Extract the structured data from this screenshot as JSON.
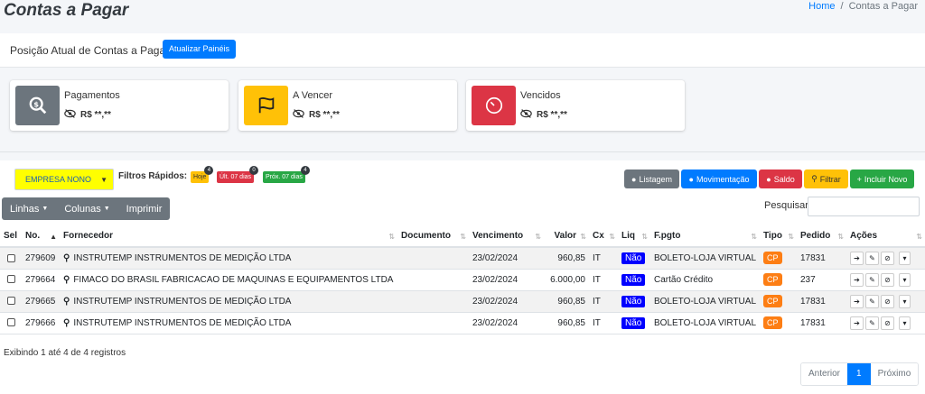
{
  "header": {
    "title": "Contas a Pagar",
    "breadcrumb_home": "Home",
    "breadcrumb_sep": "/",
    "breadcrumb_current": "Contas a Pagar"
  },
  "position": {
    "title": "Posição Atual de Contas a Pagar",
    "refresh_label": "Atualizar Painéis"
  },
  "cards": [
    {
      "label": "Pagamentos",
      "value": "R$ **,**",
      "color": "#6c757d",
      "icon": "search-dollar-icon"
    },
    {
      "label": "A Vencer",
      "value": "R$ **,**",
      "color": "#ffc107",
      "icon": "flag-icon"
    },
    {
      "label": "Vencidos",
      "value": "R$ **,**",
      "color": "#dc3545",
      "icon": "clock-icon"
    }
  ],
  "filters": {
    "empresa": "EMPRESA NONO",
    "quick_label": "Filtros Rápidos:",
    "quick": [
      {
        "label": "Hoje",
        "count": "4",
        "bg": "#ffc107",
        "fg": "#333"
      },
      {
        "label": "Últ. 07 dias",
        "count": "0",
        "bg": "#dc3545",
        "fg": "#fff"
      },
      {
        "label": "Próx. 07 dias",
        "count": "4",
        "bg": "#28a745",
        "fg": "#fff"
      }
    ]
  },
  "actions": {
    "listagem": "Listagem",
    "movimentacao": "Movimentação",
    "saldo": "Saldo",
    "filtrar": "Filtrar",
    "incluir": "Incluir Novo"
  },
  "toolbar": {
    "linhas": "Linhas",
    "colunas": "Colunas",
    "imprimir": "Imprimir",
    "search_label": "Pesquisar"
  },
  "table": {
    "headers": {
      "sel": "Sel",
      "no": "No.",
      "fornecedor": "Fornecedor",
      "documento": "Documento",
      "vencimento": "Vencimento",
      "valor": "Valor",
      "cx": "Cx",
      "liq": "Liq",
      "fpgto": "F.pgto",
      "tipo": "Tipo",
      "pedido": "Pedido",
      "acoes": "Ações"
    },
    "rows": [
      {
        "no": "279609",
        "fornecedor": "INSTRUTEMP INSTRUMENTOS DE MEDIÇÃO LTDA",
        "documento": "",
        "vencimento": "23/02/2024",
        "valor": "960,85",
        "cx": "IT",
        "liq": "Não",
        "fpgto": "BOLETO-LOJA VIRTUAL",
        "tipo": "CP",
        "pedido": "17831"
      },
      {
        "no": "279664",
        "fornecedor": "FIMACO DO BRASIL FABRICACAO DE MAQUINAS E EQUIPAMENTOS LTDA",
        "documento": "",
        "vencimento": "23/02/2024",
        "valor": "6.000,00",
        "cx": "IT",
        "liq": "Não",
        "fpgto": "Cartão Crédito",
        "tipo": "CP",
        "pedido": "237"
      },
      {
        "no": "279665",
        "fornecedor": "INSTRUTEMP INSTRUMENTOS DE MEDIÇÃO LTDA",
        "documento": "",
        "vencimento": "23/02/2024",
        "valor": "960,85",
        "cx": "IT",
        "liq": "Não",
        "fpgto": "BOLETO-LOJA VIRTUAL",
        "tipo": "CP",
        "pedido": "17831"
      },
      {
        "no": "279666",
        "fornecedor": "INSTRUTEMP INSTRUMENTOS DE MEDIÇÃO LTDA",
        "documento": "",
        "vencimento": "23/02/2024",
        "valor": "960,85",
        "cx": "IT",
        "liq": "Não",
        "fpgto": "BOLETO-LOJA VIRTUAL",
        "tipo": "CP",
        "pedido": "17831"
      }
    ]
  },
  "footer": {
    "info": "Exibindo 1 até 4 de 4 registros",
    "prev": "Anterior",
    "page": "1",
    "next": "Próximo"
  }
}
